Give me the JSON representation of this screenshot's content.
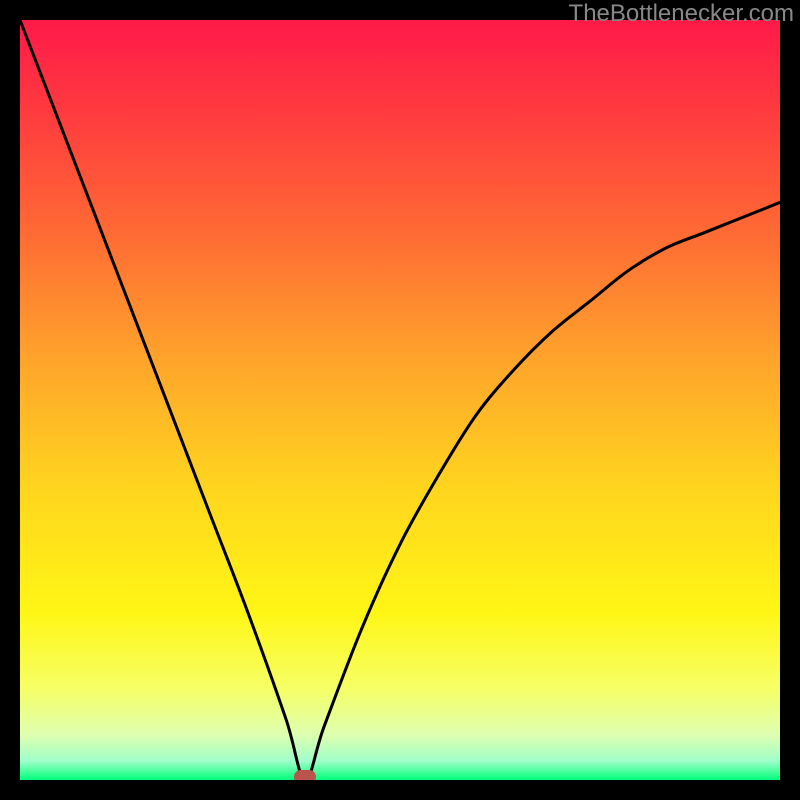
{
  "attribution": "TheBottlenecker.com",
  "chart_data": {
    "type": "line",
    "title": "",
    "xlabel": "",
    "ylabel": "",
    "xlim": [
      0,
      100
    ],
    "ylim": [
      0,
      100
    ],
    "categories_note": "x is normalized 0–100 across plot width; y is 0 (bottom/green) to 100 (top/red)",
    "series": [
      {
        "name": "bottleneck-curve",
        "x": [
          0,
          5,
          10,
          15,
          20,
          25,
          30,
          35,
          37.5,
          40,
          45,
          50,
          55,
          60,
          65,
          70,
          75,
          80,
          85,
          90,
          95,
          100
        ],
        "y": [
          100,
          87,
          74,
          61,
          48,
          35,
          22,
          8,
          0,
          7,
          20,
          31,
          40,
          48,
          54,
          59,
          63,
          67,
          70,
          72,
          74,
          76
        ]
      }
    ],
    "marker": {
      "name": "min-point-marker",
      "x": 37.5,
      "y": 0,
      "color": "#b9534c"
    },
    "gradient_stops": [
      {
        "offset": 0.0,
        "color": "#ff1a49"
      },
      {
        "offset": 0.12,
        "color": "#ff3a3f"
      },
      {
        "offset": 0.28,
        "color": "#ff6a34"
      },
      {
        "offset": 0.45,
        "color": "#ffa52b"
      },
      {
        "offset": 0.62,
        "color": "#ffd61e"
      },
      {
        "offset": 0.78,
        "color": "#fff615"
      },
      {
        "offset": 0.88,
        "color": "#f6ff66"
      },
      {
        "offset": 0.94,
        "color": "#dfffb0"
      },
      {
        "offset": 0.975,
        "color": "#9fffc8"
      },
      {
        "offset": 1.0,
        "color": "#00ff7a"
      }
    ]
  }
}
